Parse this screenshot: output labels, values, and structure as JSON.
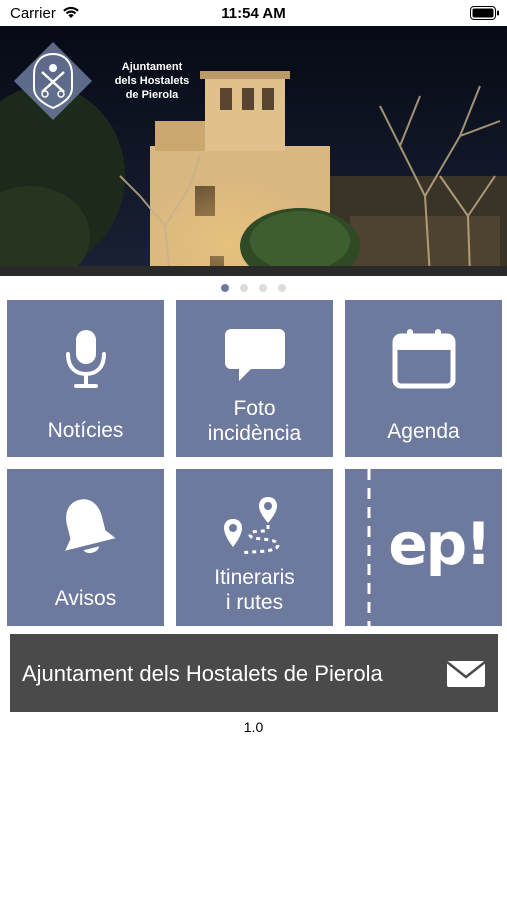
{
  "status_bar": {
    "carrier": "Carrier",
    "time": "11:54 AM"
  },
  "header": {
    "logo_line1": "Ajuntament",
    "logo_line2": "dels Hostalets",
    "logo_line3": "de Pierola"
  },
  "carousel": {
    "page_count": 4,
    "active_index": 0
  },
  "tiles": [
    {
      "label": "Notícies",
      "icon": "microphone-icon"
    },
    {
      "label_line1": "Foto",
      "label_line2": "incidència",
      "icon": "speech-bubble-icon"
    },
    {
      "label": "Agenda",
      "icon": "calendar-icon"
    },
    {
      "label": "Avisos",
      "icon": "bell-icon"
    },
    {
      "label_line1": "Itineraris",
      "label_line2": "i rutes",
      "icon": "route-icon"
    },
    {
      "logo_text": "ep!",
      "icon": "ep-logo"
    }
  ],
  "contact_bar": {
    "label": "Ajuntament dels Hostalets de Pierola",
    "icon": "envelope-icon"
  },
  "version": "1.0",
  "colors": {
    "tile": "#6d7a9e",
    "bar": "#4a4a4a",
    "sky": "#0b0f1e"
  }
}
